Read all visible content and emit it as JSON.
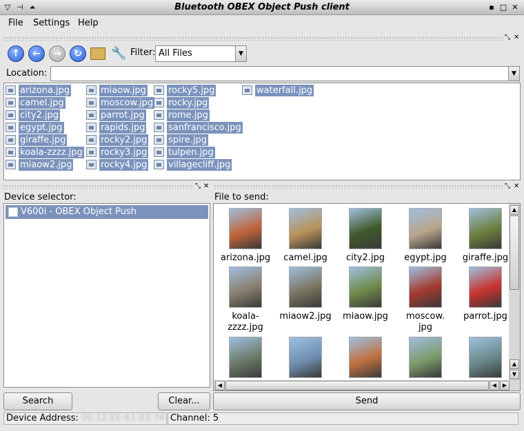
{
  "window": {
    "title": "Bluetooth OBEX Object Push client"
  },
  "menu": {
    "file": "File",
    "settings": "Settings",
    "help": "Help"
  },
  "toolbar": {
    "filter_label": "Filter:",
    "filter_value": "All Files",
    "location_label": "Location:",
    "location_value": ""
  },
  "files": [
    {
      "name": "arizona.jpg"
    },
    {
      "name": "camel.jpg"
    },
    {
      "name": "city2.jpg"
    },
    {
      "name": "egypt.jpg"
    },
    {
      "name": "giraffe.jpg"
    },
    {
      "name": "koala-zzzz.jpg"
    },
    {
      "name": "miaow2.jpg"
    },
    {
      "name": "miaow.jpg"
    },
    {
      "name": "moscow.jpg"
    },
    {
      "name": "parrot.jpg"
    },
    {
      "name": "rapids.jpg"
    },
    {
      "name": "rocky2.jpg"
    },
    {
      "name": "rocky3.jpg"
    },
    {
      "name": "rocky4.jpg"
    },
    {
      "name": "rocky5.jpg"
    },
    {
      "name": "rocky.jpg"
    },
    {
      "name": "rome.jpg"
    },
    {
      "name": "sanfrancisco.jpg"
    },
    {
      "name": "spire.jpg"
    },
    {
      "name": "tulpen.jpg"
    },
    {
      "name": "villagecliff.jpg"
    },
    {
      "name": "waterfall.jpg"
    }
  ],
  "device_panel": {
    "label": "Device selector:",
    "devices": [
      "V600i - OBEX Object Push"
    ],
    "search_label": "Search",
    "clear_label": "Clear..."
  },
  "send_panel": {
    "label": "File to send:",
    "send_label": "Send",
    "thumbs": [
      {
        "line1": "arizona.jpg",
        "line2": "",
        "color": "#c0643a"
      },
      {
        "line1": "camel.jpg",
        "line2": "",
        "color": "#b9925a"
      },
      {
        "line1": "city2.jpg",
        "line2": "",
        "color": "#3f5a2a"
      },
      {
        "line1": "egypt.jpg",
        "line2": "",
        "color": "#b9a58a"
      },
      {
        "line1": "giraffe.jpg",
        "line2": "",
        "color": "#6d7f3e"
      },
      {
        "line1": "koala-",
        "line2": "zzzz.jpg",
        "color": "#8a7f6e"
      },
      {
        "line1": "miaow2.jpg",
        "line2": "",
        "color": "#7a7560"
      },
      {
        "line1": "miaow.jpg",
        "line2": "",
        "color": "#6f8a4a"
      },
      {
        "line1": "moscow.",
        "line2": "jpg",
        "color": "#a33a2e"
      },
      {
        "line1": "parrot.jpg",
        "line2": "",
        "color": "#c8322e"
      },
      {
        "line1": "",
        "line2": "",
        "color": "#6c7a6a"
      },
      {
        "line1": "",
        "line2": "",
        "color": "#6f8fb0"
      },
      {
        "line1": "",
        "line2": "",
        "color": "#c07040"
      },
      {
        "line1": "",
        "line2": "",
        "color": "#7d9a6a"
      },
      {
        "line1": "",
        "line2": "",
        "color": "#6a8a8a"
      }
    ]
  },
  "status": {
    "address_label": "Device Address:",
    "address_value": "00:12:EE:61:83:74",
    "channel_label": "Channel: 5"
  }
}
